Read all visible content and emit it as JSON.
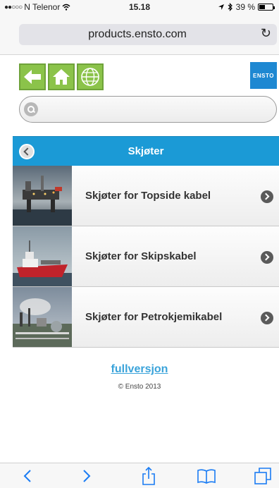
{
  "status": {
    "carrier": "N Telenor",
    "time": "15.18",
    "battery": "39 %"
  },
  "browser": {
    "url": "products.ensto.com"
  },
  "brand": {
    "logo_text": "ENSTO",
    "accent_color": "#1b9ad6",
    "nav_green": "#8bc34a"
  },
  "search": {
    "placeholder": ""
  },
  "section": {
    "title": "Skjøter"
  },
  "products": [
    {
      "label": "Skjøter for Topside kabel"
    },
    {
      "label": "Skjøter for Skipskabel"
    },
    {
      "label": "Skjøter for Petrokjemikabel"
    }
  ],
  "footer": {
    "full_version_link": "fullversjon",
    "copyright": "© Ensto 2013"
  }
}
